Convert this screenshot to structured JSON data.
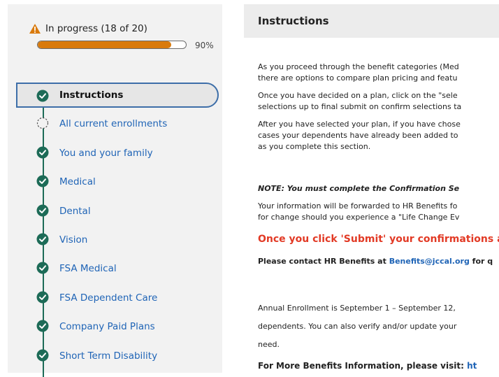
{
  "status": {
    "text": "In progress (18 of 20)",
    "percent_label": "90%",
    "progress_fraction": 0.9,
    "accent": "#d97a0c"
  },
  "steps": [
    {
      "label": "Instructions",
      "state": "done",
      "active": true
    },
    {
      "label": "All current enrollments",
      "state": "pending"
    },
    {
      "label": "You and your family",
      "state": "done"
    },
    {
      "label": "Medical",
      "state": "done"
    },
    {
      "label": "Dental",
      "state": "done"
    },
    {
      "label": "Vision",
      "state": "done"
    },
    {
      "label": "FSA Medical",
      "state": "done"
    },
    {
      "label": "FSA Dependent Care",
      "state": "done"
    },
    {
      "label": "Company Paid Plans",
      "state": "done"
    },
    {
      "label": "Short Term Disability",
      "state": "done"
    }
  ],
  "main": {
    "title": "Instructions",
    "lines": [
      "As you proceed through the benefit categories (Med",
      "there are options to compare plan pricing and featu",
      "Once you have decided on a plan, click on the \"sele",
      "selections up to final submit on confirm selections ta",
      "After you have selected your plan, if you have chose",
      "cases your dependents have already been added to",
      "as you complete this section."
    ],
    "note": "NOTE: You must complete the Confirmation Se",
    "forward_lines": [
      "Your information will be forwarded to HR Benefits fo",
      "for change should you experience a \"Life Change Ev"
    ],
    "warning": "Once you click 'Submit' your confirmations ar",
    "contact_prefix": "Please contact HR Benefits at ",
    "contact_email": "Benefits@jccal.org",
    "contact_suffix": " for q",
    "enrollment_lines": [
      "Annual Enrollment is September 1 – September 12,",
      "dependents. You can also verify and/or update your",
      "need."
    ],
    "more_info_prefix": "For More Benefits Information, please visit: ",
    "more_info_link": "ht"
  },
  "colors": {
    "done": "#1d6b57",
    "link": "#1f64b6",
    "warning": "#e23a25"
  }
}
